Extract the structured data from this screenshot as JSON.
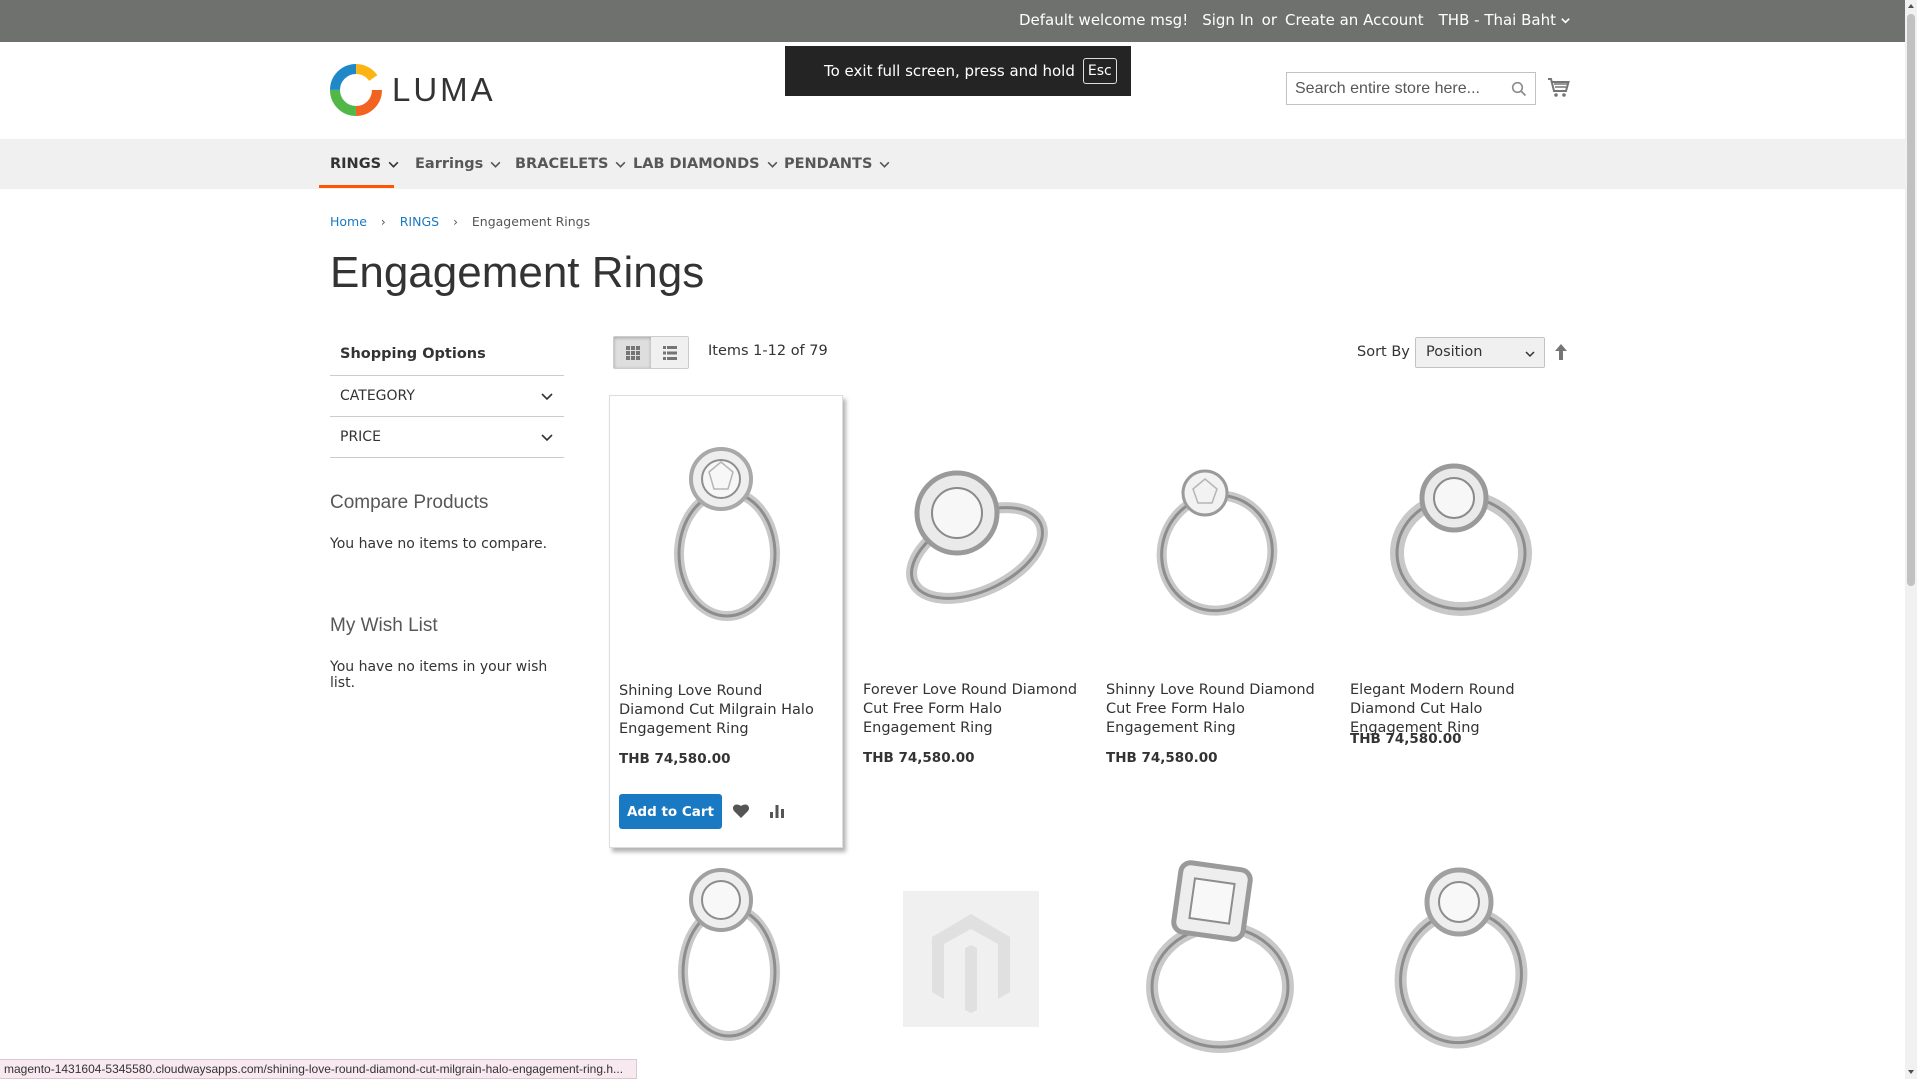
{
  "topbar": {
    "welcome": "Default welcome msg!",
    "sign_in": "Sign In",
    "or": "or",
    "create_account": "Create an Account",
    "currency": "THB - Thai Baht"
  },
  "header": {
    "logo_text": "LUMA",
    "fullscreen_notice": "To exit full screen, press and hold",
    "fullscreen_key": "Esc",
    "search_placeholder": "Search entire store here..."
  },
  "nav": {
    "items": [
      {
        "label": "RINGS"
      },
      {
        "label": "Earrings"
      },
      {
        "label": "BRACELETS"
      },
      {
        "label": "LAB DIAMONDS"
      },
      {
        "label": "PENDANTS"
      }
    ],
    "active_color": "#ff5501"
  },
  "breadcrumb": {
    "home": "Home",
    "rings": "RINGS",
    "current": "Engagement Rings"
  },
  "page_title": "Engagement Rings",
  "sidebar": {
    "title": "Shopping Options",
    "filters": [
      "CATEGORY",
      "PRICE"
    ],
    "compare_title": "Compare Products",
    "compare_text": "You have no items to compare.",
    "wishlist_title": "My Wish List",
    "wishlist_text": "You have no items in your wish list."
  },
  "toolbar": {
    "items_count": "Items 1-12 of 79",
    "sort_label": "Sort By",
    "sort_value": "Position"
  },
  "products": [
    {
      "name": "Shining Love Round Diamond Cut Milgrain Halo Engagement Ring",
      "price": "THB 74,580.00",
      "add_to_cart": "Add to Cart"
    },
    {
      "name": "Forever Love Round Diamond Cut Free Form Halo Engagement Ring",
      "price": "THB 74,580.00"
    },
    {
      "name": "Shinny Love Round Diamond Cut Free Form Halo Engagement Ring",
      "price": "THB 74,580.00"
    },
    {
      "name": "Elegant Modern Round Diamond Cut Halo Engagement Ring",
      "price": "THB 74,580.00"
    }
  ],
  "status_url": "magento-1431604-5345580.cloudwaysapps.com/shining-love-round-diamond-cut-milgrain-halo-engagement-ring.h...",
  "colors": {
    "topbar_bg": "#6e716e",
    "link_blue": "#1979c3",
    "nav_bg": "#f0f0f0"
  }
}
